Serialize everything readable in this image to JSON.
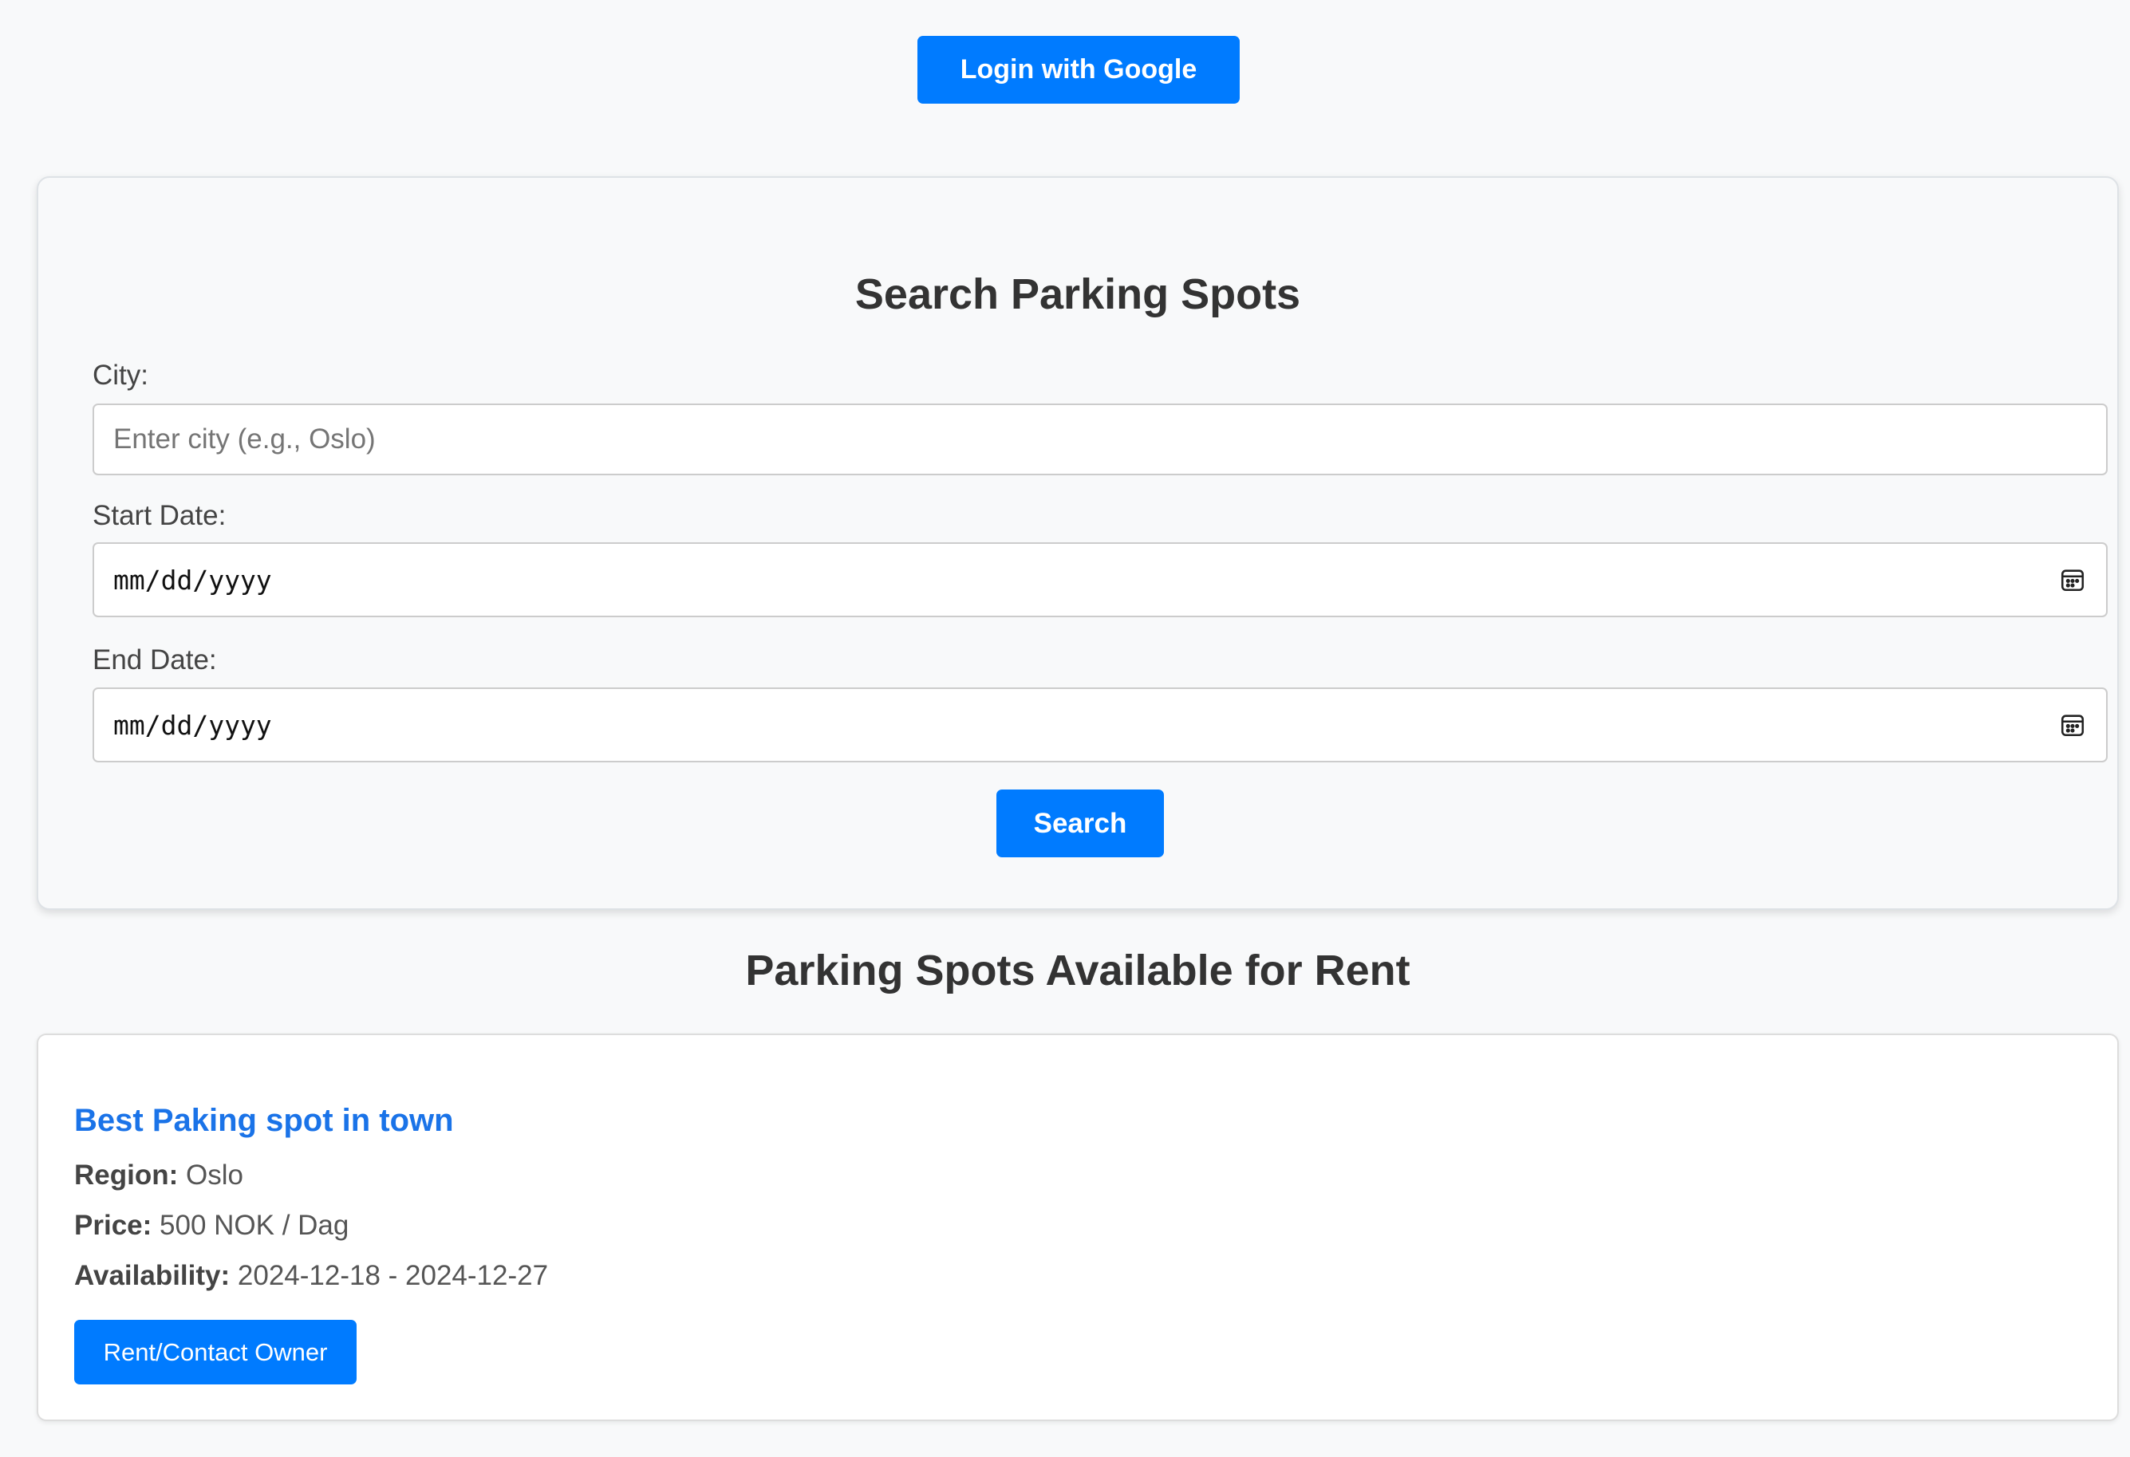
{
  "header": {
    "login_label": "Login with Google"
  },
  "search": {
    "title": "Search Parking Spots",
    "city_label": "City:",
    "city_placeholder": "Enter city (e.g., Oslo)",
    "city_value": "",
    "start_label": "Start Date:",
    "start_value": "mm/dd/yyyy",
    "end_label": "End Date:",
    "end_value": "mm/dd/yyyy",
    "calendar_icon": "calendar-icon",
    "search_label": "Search"
  },
  "listings": {
    "title": "Parking Spots Available for Rent",
    "spots": [
      {
        "title": "Best Paking spot in town",
        "region_key": "Region:",
        "region": "Oslo",
        "price_key": "Price:",
        "price": "500 NOK / Dag",
        "availability_key": "Availability:",
        "availability": "2024-12-18 - 2024-12-27",
        "action_label": "Rent/Contact Owner"
      }
    ]
  },
  "colors": {
    "accent": "#007bff",
    "link": "#1a73e8",
    "background": "#f8f9fa"
  }
}
